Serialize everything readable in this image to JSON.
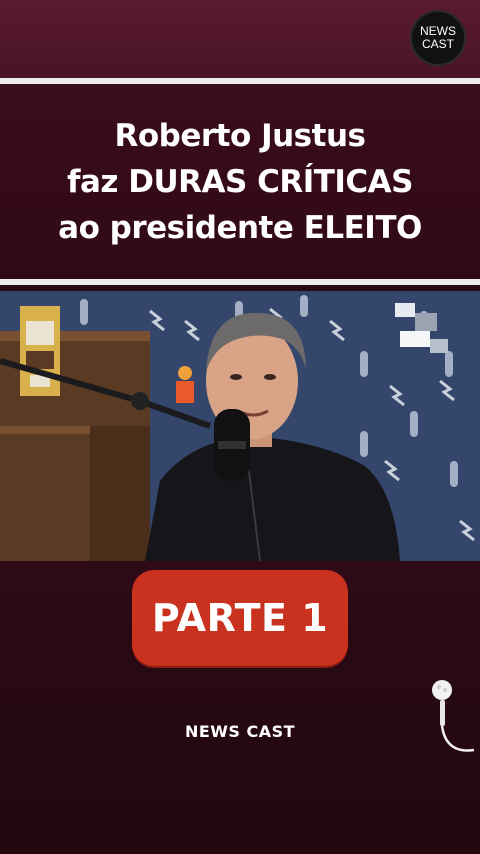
{
  "logo": {
    "line1": "NEWS",
    "line2": "CAST"
  },
  "headline": {
    "line1": "Roberto Justus",
    "line2": "faz DURAS CRÍTICAS",
    "line3": "ao presidente ELEITO"
  },
  "video_frame": {
    "description_icon": "podcast-mic-icon"
  },
  "part_button": {
    "label": "PARTE 1"
  },
  "footer": {
    "brand": "NEWS CAST"
  },
  "colors": {
    "background": "#2a0a16",
    "accent_button": "#c8321e",
    "rule": "#ecebee",
    "text": "#ffffff"
  }
}
